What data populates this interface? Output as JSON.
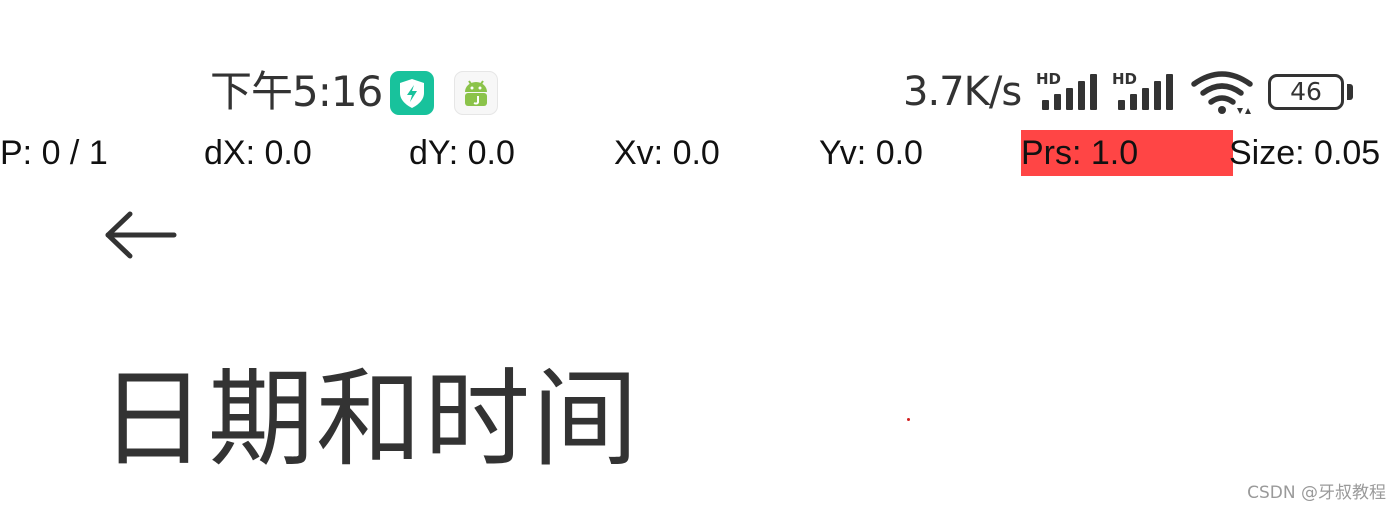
{
  "status_bar": {
    "time": "下午5:16",
    "app_icons": [
      "shield-lightning-icon",
      "android-icon"
    ],
    "network_speed": "3.7K/s",
    "signal_label": "HD",
    "battery_level": "46",
    "colors": {
      "security_icon": "#18c29c",
      "android_green": "#8bc34a"
    }
  },
  "pointer_location": {
    "p": "P: 0 / 1",
    "dx": "dX: 0.0",
    "dy": "dY: 0.0",
    "xv": "Xv: 0.0",
    "yv": "Yv: 0.0",
    "prs": "Prs: 1.0",
    "size": "Size: 0.05",
    "colors": {
      "prs_highlight": "#ff4545"
    }
  },
  "page": {
    "back_icon": "arrow-left-icon",
    "title": "日期和时间"
  },
  "watermark": "CSDN @牙叔教程"
}
